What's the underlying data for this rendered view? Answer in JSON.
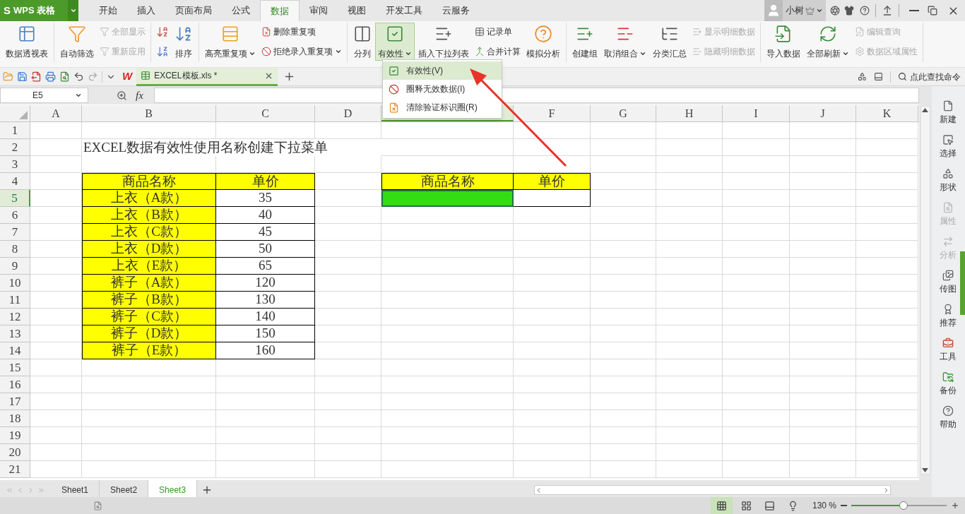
{
  "title_bar": {
    "logo": "S",
    "app_name": "WPS 表格",
    "user": "小树"
  },
  "menu_tabs": [
    {
      "label": "开始",
      "selected": false
    },
    {
      "label": "插入",
      "selected": false
    },
    {
      "label": "页面布局",
      "selected": false
    },
    {
      "label": "公式",
      "selected": false
    },
    {
      "label": "数据",
      "selected": true
    },
    {
      "label": "审阅",
      "selected": false
    },
    {
      "label": "视图",
      "selected": false
    },
    {
      "label": "开发工具",
      "selected": false
    },
    {
      "label": "云服务",
      "selected": false
    }
  ],
  "ribbon": {
    "groups": [
      {
        "items": [
          {
            "label": "数据透视表",
            "kind": "large",
            "disabled": false,
            "dropdown": false,
            "expanded": false
          }
        ]
      },
      {
        "items": [
          {
            "label": "自动筛选",
            "kind": "large",
            "disabled": false,
            "dropdown": false,
            "expanded": false
          },
          {
            "label": "全部显示",
            "kind": "small",
            "disabled": true,
            "dropdown": false,
            "expanded": false
          },
          {
            "label": "重新应用",
            "kind": "small",
            "disabled": true,
            "dropdown": false,
            "expanded": false
          }
        ]
      },
      {
        "items": [
          {
            "kind": "small",
            "disabled": false,
            "dropdown": false,
            "expanded": false
          },
          {
            "kind": "small",
            "disabled": false,
            "dropdown": false,
            "expanded": false
          },
          {
            "label": "排序",
            "kind": "large",
            "disabled": false,
            "dropdown": false,
            "expanded": false
          }
        ]
      },
      {
        "items": [
          {
            "label": "高亮重复项",
            "kind": "large",
            "disabled": false,
            "dropdown": true,
            "expanded": false
          },
          {
            "label": "删除重复项",
            "kind": "small",
            "disabled": false,
            "dropdown": false,
            "expanded": false
          },
          {
            "label": "拒绝录入重复项",
            "kind": "small",
            "disabled": false,
            "dropdown": true,
            "expanded": false
          }
        ]
      },
      {
        "items": [
          {
            "label": "分列",
            "kind": "large",
            "disabled": false,
            "dropdown": false,
            "expanded": false
          },
          {
            "label": "有效性",
            "kind": "large",
            "disabled": false,
            "dropdown": true,
            "expanded": true
          },
          {
            "label": "插入下拉列表",
            "kind": "large",
            "disabled": false,
            "dropdown": false,
            "expanded": false
          },
          {
            "label": "记录单",
            "kind": "small",
            "disabled": false,
            "dropdown": false,
            "expanded": false
          },
          {
            "label": "合并计算",
            "kind": "small",
            "disabled": false,
            "dropdown": false,
            "expanded": false
          },
          {
            "label": "模拟分析",
            "kind": "large",
            "disabled": false,
            "dropdown": false,
            "expanded": false
          }
        ]
      },
      {
        "items": [
          {
            "label": "创建组",
            "kind": "large",
            "disabled": false,
            "dropdown": false,
            "expanded": false
          },
          {
            "label": "取消组合",
            "kind": "large",
            "disabled": false,
            "dropdown": true,
            "expanded": false
          },
          {
            "label": "分类汇总",
            "kind": "large",
            "disabled": false,
            "dropdown": false,
            "expanded": false
          },
          {
            "label": "显示明细数据",
            "kind": "small",
            "disabled": true,
            "dropdown": false,
            "expanded": false
          },
          {
            "label": "隐藏明细数据",
            "kind": "small",
            "disabled": true,
            "dropdown": false,
            "expanded": false
          }
        ]
      },
      {
        "items": [
          {
            "label": "导入数据",
            "kind": "large",
            "disabled": false,
            "dropdown": false,
            "expanded": false
          },
          {
            "label": "全部刷新",
            "kind": "large",
            "disabled": false,
            "dropdown": true,
            "expanded": false
          },
          {
            "label": "编辑查询",
            "kind": "small",
            "disabled": true,
            "dropdown": false,
            "expanded": false
          },
          {
            "label": "数据区域属性",
            "kind": "small",
            "disabled": true,
            "dropdown": false,
            "expanded": false
          }
        ]
      }
    ]
  },
  "dropdown_menu": [
    {
      "label": "有效性(V)",
      "selected": true
    },
    {
      "label": "圈释无效数据(I)",
      "selected": false
    },
    {
      "label": "清除验证标识圈(R)",
      "selected": false
    }
  ],
  "doc_bar": {
    "logo": "W",
    "tabs": [
      {
        "label": "EXCEL模板.xls *",
        "selected": true
      }
    ],
    "search": "点此查找命令"
  },
  "formula_bar": {
    "cell_ref": "E5",
    "fx": "fx"
  },
  "sheet": {
    "columns": [
      {
        "label": "A",
        "selected": false
      },
      {
        "label": "B",
        "selected": false
      },
      {
        "label": "C",
        "selected": false
      },
      {
        "label": "D",
        "selected": false
      },
      {
        "selected": true
      },
      {
        "label": "F",
        "selected": false
      },
      {
        "label": "G",
        "selected": false
      },
      {
        "label": "H",
        "selected": false
      },
      {
        "label": "I",
        "selected": false
      },
      {
        "label": "J",
        "selected": false
      },
      {
        "label": "K",
        "selected": false
      }
    ],
    "rows": [
      {
        "label": "1",
        "selected": false
      },
      {
        "label": "2",
        "selected": false
      },
      {
        "label": "3",
        "selected": false
      },
      {
        "label": "4",
        "selected": false
      },
      {
        "label": "5",
        "selected": true
      },
      {
        "label": "6",
        "selected": false
      },
      {
        "label": "7",
        "selected": false
      },
      {
        "label": "8",
        "selected": false
      },
      {
        "label": "9",
        "selected": false
      },
      {
        "label": "10",
        "selected": false
      },
      {
        "label": "11",
        "selected": false
      },
      {
        "label": "12",
        "selected": false
      },
      {
        "label": "13",
        "selected": false
      },
      {
        "label": "14",
        "selected": false
      },
      {
        "label": "15",
        "selected": false
      },
      {
        "label": "16",
        "selected": false
      },
      {
        "label": "17",
        "selected": false
      },
      {
        "label": "18",
        "selected": false
      },
      {
        "label": "19",
        "selected": false
      },
      {
        "label": "20",
        "selected": false
      },
      {
        "label": "21",
        "selected": false
      }
    ],
    "title": "EXCEL数据有效性使用名称创建下拉菜单",
    "product_table": {
      "header": [
        "商品名称",
        "单价"
      ],
      "rows": [
        [
          "上衣（A款）",
          "35"
        ],
        [
          "上衣（B款）",
          "40"
        ],
        [
          "上衣（C款）",
          "45"
        ],
        [
          "上衣（D款）",
          "50"
        ],
        [
          "上衣（E款）",
          "65"
        ],
        [
          "裤子（A款）",
          "120"
        ],
        [
          "裤子（B款）",
          "130"
        ],
        [
          "裤子（C款）",
          "140"
        ],
        [
          "裤子（D款）",
          "150"
        ],
        [
          "裤子（E款）",
          "160"
        ]
      ]
    },
    "lookup_table": {
      "header": [
        "商品名称",
        "单价"
      ]
    }
  },
  "sheet_tabs": [
    {
      "label": "Sheet1",
      "selected": false
    },
    {
      "label": "Sheet2",
      "selected": false
    },
    {
      "label": "Sheet3",
      "selected": true
    }
  ],
  "right_panel": [
    {
      "label": "新建",
      "disabled": false
    },
    {
      "label": "选择",
      "disabled": false
    },
    {
      "label": "形状",
      "disabled": false
    },
    {
      "label": "属性",
      "disabled": true
    },
    {
      "label": "分析",
      "disabled": true
    },
    {
      "label": "传图",
      "disabled": false
    },
    {
      "label": "推荐",
      "disabled": false
    },
    {
      "label": "工具",
      "disabled": false
    },
    {
      "label": "备份",
      "disabled": false
    },
    {
      "label": "帮助",
      "disabled": false
    }
  ],
  "status_bar": {
    "zoom": "130 %",
    "zoom_slider": {
      "level": 0.55
    }
  }
}
